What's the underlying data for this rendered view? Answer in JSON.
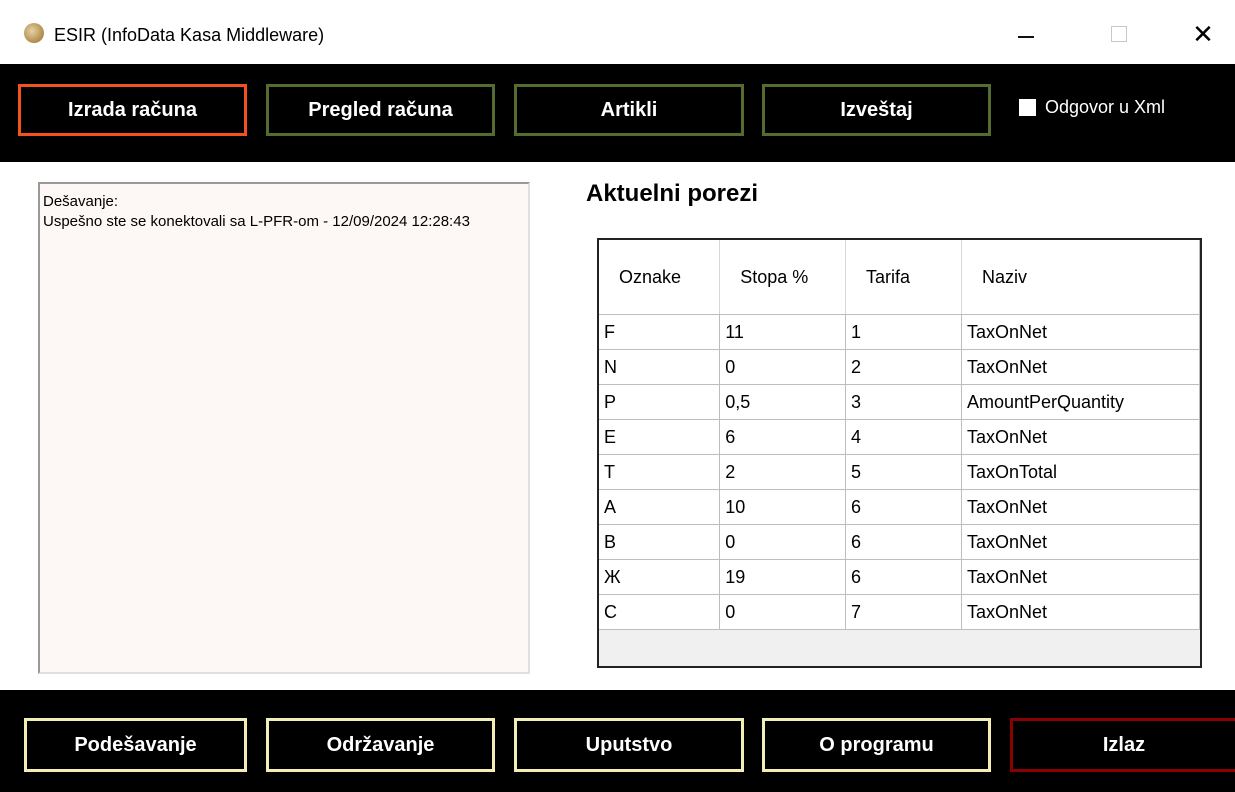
{
  "window": {
    "title": "ESIR (InfoData Kasa Middleware)",
    "icon": "app-logo-icon",
    "controls": {
      "minimize": "minimize-icon",
      "maximize": "maximize-icon",
      "close": "close-icon",
      "close_glyph": "✕"
    }
  },
  "toolbar": {
    "buttons": [
      "Izrada računa",
      "Pregled računa",
      "Artikli",
      "Izveštaj"
    ],
    "active_index": 0,
    "checkbox_label": "Odgovor u Xml",
    "checkbox_checked": false
  },
  "log": {
    "lines": [
      "Dešavanje:",
      "Uspešno ste se konektovali sa L-PFR-om - 12/09/2024 12:28:43"
    ]
  },
  "taxes": {
    "title": "Aktuelni porezi",
    "columns": [
      "Oznake",
      "Stopa %",
      "Tarifa",
      "Naziv"
    ],
    "rows": [
      [
        "F",
        "11",
        "1",
        "TaxOnNet"
      ],
      [
        "N",
        "0",
        "2",
        "TaxOnNet"
      ],
      [
        "P",
        "0,5",
        "3",
        "AmountPerQuantity"
      ],
      [
        "E",
        "6",
        "4",
        "TaxOnNet"
      ],
      [
        "T",
        "2",
        "5",
        "TaxOnTotal"
      ],
      [
        "А",
        "10",
        "6",
        "TaxOnNet"
      ],
      [
        "В",
        "0",
        "6",
        "TaxOnNet"
      ],
      [
        "Ж",
        "19",
        "6",
        "TaxOnNet"
      ],
      [
        "С",
        "0",
        "7",
        "TaxOnNet"
      ]
    ]
  },
  "footer": {
    "buttons": [
      "Podešavanje",
      "Održavanje",
      "Uputstvo",
      "O programu",
      "Izlaz"
    ]
  },
  "colors": {
    "active_border": "#f4511e",
    "top_border": "#556b2f",
    "bottom_border": "#f3eeb8",
    "exit_border": "#8b0000"
  }
}
